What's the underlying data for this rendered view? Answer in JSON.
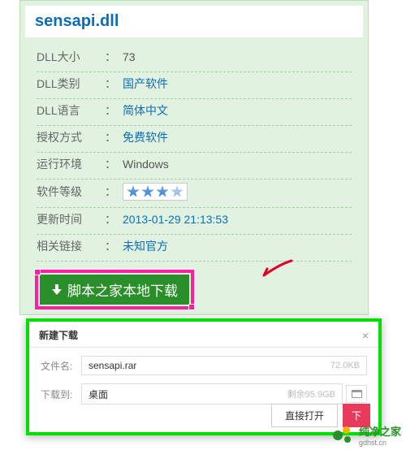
{
  "title": "sensapi.dll",
  "rows": {
    "size": {
      "label": "DLL大小",
      "value": "73"
    },
    "cat": {
      "label": "DLL类别",
      "value": "国产软件",
      "link": true
    },
    "lang": {
      "label": "DLL语言",
      "value": "简体中文",
      "link": true
    },
    "lic": {
      "label": "授权方式",
      "value": "免费软件",
      "link": true
    },
    "env": {
      "label": "运行环境",
      "value": "Windows"
    },
    "rating": {
      "label": "软件等级",
      "value": "3"
    },
    "time": {
      "label": "更新时间",
      "value": "2013-01-29 21:13:53",
      "link": true
    },
    "rel": {
      "label": "相关链接",
      "value": "未知官方",
      "link": true
    }
  },
  "download_button": "脚本之家本地下载",
  "dialog": {
    "title": "新建下载",
    "filename_label": "文件名:",
    "filename": "sensapi.rar",
    "filesize": "72.0KB",
    "saveto_label": "下载到:",
    "saveto": "桌面",
    "remaining": "剩余95.9GB",
    "open_btn": "直接打开",
    "download_btn": "下"
  },
  "watermark": "纯净之家",
  "watermark_url": "gdhst.cn"
}
